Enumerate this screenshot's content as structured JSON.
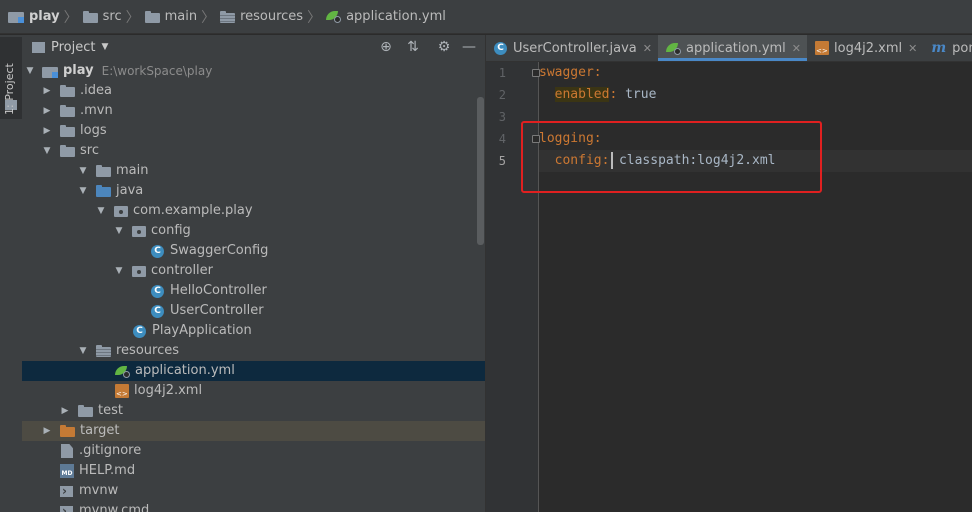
{
  "breadcrumb": [
    {
      "label": "play",
      "icon": "module-folder-icon"
    },
    {
      "label": "src",
      "icon": "folder-icon"
    },
    {
      "label": "main",
      "icon": "folder-icon"
    },
    {
      "label": "resources",
      "icon": "resources-folder-icon"
    },
    {
      "label": "application.yml",
      "icon": "spring-config-icon"
    }
  ],
  "toolstrip": {
    "project_tab": "1: Project"
  },
  "project_panel": {
    "title": "Project",
    "tree": [
      {
        "label": "play",
        "path": "E:\\workSpace\\play"
      },
      {
        "label": ".idea"
      },
      {
        "label": ".mvn"
      },
      {
        "label": "logs"
      },
      {
        "label": "src"
      },
      {
        "label": "main"
      },
      {
        "label": "java"
      },
      {
        "label": "com.example.play"
      },
      {
        "label": "config"
      },
      {
        "label": "SwaggerConfig"
      },
      {
        "label": "controller"
      },
      {
        "label": "HelloController"
      },
      {
        "label": "UserController"
      },
      {
        "label": "PlayApplication"
      },
      {
        "label": "resources"
      },
      {
        "label": "application.yml"
      },
      {
        "label": "log4j2.xml"
      },
      {
        "label": "test"
      },
      {
        "label": "target"
      },
      {
        "label": ".gitignore"
      },
      {
        "label": "HELP.md"
      },
      {
        "label": "mvnw"
      },
      {
        "label": "mvnw.cmd"
      }
    ]
  },
  "editor_tabs": [
    {
      "label": "UserController.java",
      "icon": "java-class-icon",
      "active": false
    },
    {
      "label": "application.yml",
      "icon": "spring-config-icon",
      "active": true
    },
    {
      "label": "log4j2.xml",
      "icon": "xml-file-icon",
      "active": false
    },
    {
      "label": "pom.xml",
      "icon": "maven-icon",
      "active": false
    }
  ],
  "editor": {
    "line_numbers": [
      "1",
      "2",
      "3",
      "4",
      "5"
    ],
    "lines": [
      {
        "key": "swagger",
        "colon": ":"
      },
      {
        "indent": "  ",
        "key": "enabled",
        "colon": ":",
        "value": " true"
      },
      {},
      {
        "key": "logging",
        "colon": ":"
      },
      {
        "indent": "  ",
        "key": "config",
        "colon": ":",
        "value": "classpath:log4j2.xml"
      }
    ],
    "current_line": 5
  },
  "colors": {
    "keyword_orange": "#cc7832",
    "value_text": "#a9b7c6",
    "selection_blue": "#0d293e",
    "annotation_red": "#e02020"
  }
}
